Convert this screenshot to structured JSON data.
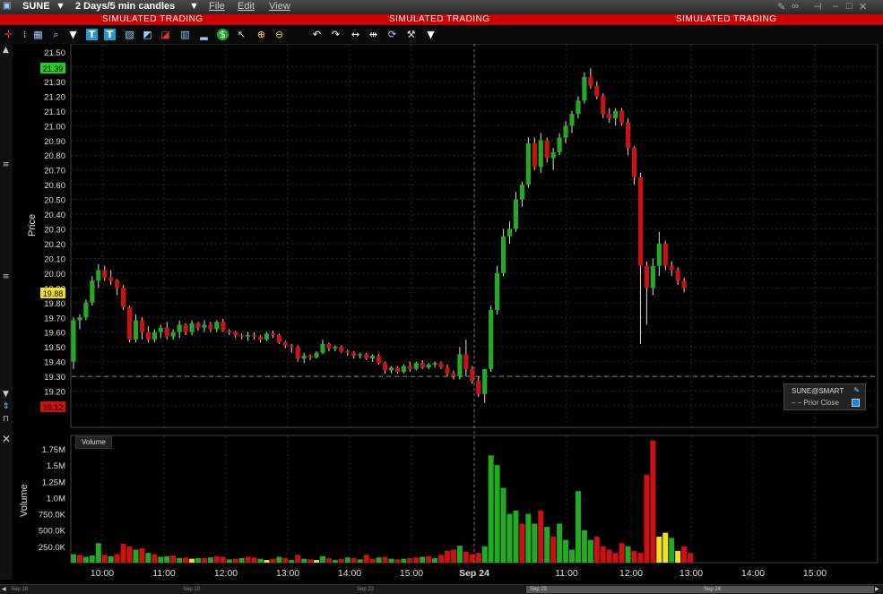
{
  "window": {
    "symbol": "SUNE",
    "period": "2 Days/5 min candles",
    "menus": [
      "File",
      "Edit",
      "View"
    ]
  },
  "banner": {
    "text": "SIMULATED TRADING",
    "color": "#cc0000"
  },
  "toolbar_icons": [
    "crosshair-icon",
    "dotted-grid-icon",
    "magnifier-icon",
    "dropdown-arrow-icon",
    "text-icon",
    "text-box-icon",
    "line-chart-icon",
    "area-chart-icon",
    "draw-line-icon",
    "bar-chart-icon",
    "volume-icon",
    "dollar-icon",
    "pointer-icon",
    "zoom-in-icon",
    "zoom-out-icon",
    "undo-icon",
    "redo-icon",
    "fit-icon",
    "split-icon",
    "refresh-icon",
    "wrench-icon",
    "more-arrow-icon"
  ],
  "price_panel": {
    "ylabel": "Price",
    "current_price_tag": "21.39",
    "prior_close_tag": "19.88",
    "low_tag": "19.12",
    "tick_labels": [
      "21.50",
      "21.40",
      "21.30",
      "21.20",
      "21.10",
      "21.00",
      "20.90",
      "20.80",
      "20.70",
      "20.60",
      "20.50",
      "20.40",
      "20.30",
      "20.20",
      "20.10",
      "20.00",
      "19.90",
      "19.80",
      "19.70",
      "19.60",
      "19.50",
      "19.40",
      "19.30",
      "19.20",
      "19.10"
    ]
  },
  "legend": {
    "title": "SUNE@SMART",
    "item": "Prior Close"
  },
  "volume_panel": {
    "badge": "Volume",
    "ylabel": "Volume",
    "tick_labels": [
      "1.75M",
      "1.5M",
      "1.25M",
      "1.0M",
      "750.0K",
      "500.0K",
      "250.0K"
    ]
  },
  "time_axis": {
    "labels": [
      "10:00",
      "11:00",
      "12:00",
      "13:00",
      "14:00",
      "15:00",
      "Sep 24",
      "11:00",
      "12:00",
      "13:00",
      "14:00",
      "15:00"
    ]
  },
  "scroller_labels": [
    "Sep 18",
    "Sep 19",
    "Sep 22",
    "Sep 23",
    "Sep 24"
  ],
  "colors": {
    "up": "#22aa22",
    "down": "#cc1111",
    "flat": "#eeeeee",
    "price_tag": "#22cc22",
    "prior_tag": "#f0e020",
    "low_tag": "#cc1111"
  },
  "chart_data": {
    "type": "candlestick",
    "ylim": [
      19.05,
      21.55
    ],
    "prior_close": 19.3,
    "ohlc": [
      [
        19.4,
        19.7,
        19.35,
        19.68
      ],
      [
        19.68,
        19.72,
        19.62,
        19.7
      ],
      [
        19.7,
        19.82,
        19.68,
        19.8
      ],
      [
        19.8,
        19.98,
        19.78,
        19.95
      ],
      [
        19.95,
        20.06,
        19.9,
        20.02
      ],
      [
        20.02,
        20.05,
        19.95,
        19.97
      ],
      [
        19.97,
        20.02,
        19.92,
        19.95
      ],
      [
        19.95,
        19.96,
        19.85,
        19.9
      ],
      [
        19.9,
        19.92,
        19.75,
        19.77
      ],
      [
        19.77,
        19.78,
        19.53,
        19.55
      ],
      [
        19.55,
        19.72,
        19.53,
        19.68
      ],
      [
        19.68,
        19.7,
        19.55,
        19.6
      ],
      [
        19.6,
        19.64,
        19.53,
        19.55
      ],
      [
        19.55,
        19.62,
        19.53,
        19.6
      ],
      [
        19.6,
        19.65,
        19.56,
        19.63
      ],
      [
        19.63,
        19.67,
        19.55,
        19.57
      ],
      [
        19.57,
        19.62,
        19.55,
        19.6
      ],
      [
        19.6,
        19.68,
        19.56,
        19.65
      ],
      [
        19.65,
        19.66,
        19.58,
        19.6
      ],
      [
        19.6,
        19.68,
        19.58,
        19.66
      ],
      [
        19.66,
        19.67,
        19.61,
        19.63
      ],
      [
        19.63,
        19.68,
        19.6,
        19.65
      ],
      [
        19.65,
        19.67,
        19.6,
        19.62
      ],
      [
        19.62,
        19.68,
        19.6,
        19.67
      ],
      [
        19.67,
        19.69,
        19.6,
        19.61
      ],
      [
        19.61,
        19.62,
        19.58,
        19.6
      ],
      [
        19.6,
        19.61,
        19.56,
        19.58
      ],
      [
        19.58,
        19.59,
        19.55,
        19.57
      ],
      [
        19.57,
        19.6,
        19.54,
        19.58
      ],
      [
        19.58,
        19.6,
        19.55,
        19.57
      ],
      [
        19.57,
        19.58,
        19.53,
        19.55
      ],
      [
        19.55,
        19.6,
        19.54,
        19.59
      ],
      [
        19.59,
        19.61,
        19.56,
        19.58
      ],
      [
        19.58,
        19.59,
        19.52,
        19.53
      ],
      [
        19.53,
        19.54,
        19.49,
        19.51
      ],
      [
        19.51,
        19.52,
        19.46,
        19.5
      ],
      [
        19.5,
        19.51,
        19.4,
        19.42
      ],
      [
        19.42,
        19.46,
        19.39,
        19.44
      ],
      [
        19.44,
        19.45,
        19.41,
        19.43
      ],
      [
        19.43,
        19.47,
        19.42,
        19.46
      ],
      [
        19.46,
        19.55,
        19.45,
        19.52
      ],
      [
        19.52,
        19.53,
        19.47,
        19.49
      ],
      [
        19.49,
        19.51,
        19.47,
        19.5
      ],
      [
        19.5,
        19.51,
        19.46,
        19.47
      ],
      [
        19.47,
        19.48,
        19.44,
        19.46
      ],
      [
        19.46,
        19.47,
        19.42,
        19.44
      ],
      [
        19.44,
        19.46,
        19.42,
        19.45
      ],
      [
        19.45,
        19.46,
        19.41,
        19.42
      ],
      [
        19.42,
        19.45,
        19.4,
        19.44
      ],
      [
        19.44,
        19.45,
        19.38,
        19.39
      ],
      [
        19.39,
        19.4,
        19.32,
        19.34
      ],
      [
        19.34,
        19.37,
        19.32,
        19.36
      ],
      [
        19.36,
        19.37,
        19.32,
        19.33
      ],
      [
        19.33,
        19.38,
        19.32,
        19.37
      ],
      [
        19.37,
        19.4,
        19.33,
        19.35
      ],
      [
        19.35,
        19.4,
        19.34,
        19.39
      ],
      [
        19.39,
        19.41,
        19.35,
        19.36
      ],
      [
        19.36,
        19.39,
        19.35,
        19.38
      ],
      [
        19.38,
        19.4,
        19.36,
        19.39
      ],
      [
        19.39,
        19.4,
        19.35,
        19.36
      ],
      [
        19.36,
        19.38,
        19.3,
        19.32
      ],
      [
        19.32,
        19.34,
        19.28,
        19.3
      ],
      [
        19.3,
        19.5,
        19.28,
        19.45
      ],
      [
        19.45,
        19.55,
        19.3,
        19.35
      ],
      [
        19.35,
        19.37,
        19.25,
        19.27
      ],
      [
        19.27,
        19.3,
        19.16,
        19.18
      ],
      [
        19.18,
        19.35,
        19.12,
        19.35
      ],
      [
        19.35,
        19.78,
        19.33,
        19.75
      ],
      [
        19.75,
        20.05,
        19.72,
        20.0
      ],
      [
        20.0,
        20.3,
        19.98,
        20.25
      ],
      [
        20.25,
        20.35,
        20.2,
        20.3
      ],
      [
        20.3,
        20.55,
        20.28,
        20.5
      ],
      [
        20.5,
        20.62,
        20.45,
        20.6
      ],
      [
        20.6,
        20.92,
        20.58,
        20.88
      ],
      [
        20.88,
        20.92,
        20.7,
        20.72
      ],
      [
        20.72,
        20.95,
        20.68,
        20.9
      ],
      [
        20.9,
        20.92,
        20.75,
        20.78
      ],
      [
        20.78,
        20.85,
        20.7,
        20.82
      ],
      [
        20.82,
        20.95,
        20.8,
        20.92
      ],
      [
        20.92,
        21.03,
        20.88,
        21.0
      ],
      [
        21.0,
        21.1,
        20.95,
        21.08
      ],
      [
        21.08,
        21.2,
        21.05,
        21.17
      ],
      [
        21.17,
        21.36,
        21.15,
        21.33
      ],
      [
        21.33,
        21.39,
        21.25,
        21.27
      ],
      [
        21.27,
        21.3,
        21.18,
        21.2
      ],
      [
        21.2,
        21.22,
        21.05,
        21.08
      ],
      [
        21.08,
        21.12,
        21.02,
        21.05
      ],
      [
        21.05,
        21.12,
        21.0,
        21.1
      ],
      [
        21.1,
        21.12,
        21.0,
        21.02
      ],
      [
        21.02,
        21.05,
        20.8,
        20.85
      ],
      [
        20.85,
        20.86,
        20.6,
        20.65
      ],
      [
        20.65,
        20.68,
        19.52,
        20.05
      ],
      [
        20.05,
        20.08,
        19.65,
        19.9
      ],
      [
        19.9,
        20.1,
        19.85,
        20.05
      ],
      [
        20.05,
        20.28,
        19.98,
        20.2
      ],
      [
        20.2,
        20.22,
        20.02,
        20.05
      ],
      [
        20.05,
        20.08,
        19.98,
        20.02
      ],
      [
        20.02,
        20.04,
        19.92,
        19.95
      ],
      [
        19.95,
        19.97,
        19.87,
        19.9
      ]
    ],
    "volume": [
      [
        130,
        0
      ],
      [
        120,
        1
      ],
      [
        90,
        0
      ],
      [
        110,
        0
      ],
      [
        300,
        0
      ],
      [
        120,
        1
      ],
      [
        100,
        0
      ],
      [
        130,
        1
      ],
      [
        290,
        1
      ],
      [
        250,
        1
      ],
      [
        200,
        0
      ],
      [
        220,
        1
      ],
      [
        150,
        0
      ],
      [
        130,
        1
      ],
      [
        90,
        0
      ],
      [
        100,
        0
      ],
      [
        110,
        1
      ],
      [
        70,
        0
      ],
      [
        80,
        1
      ],
      [
        60,
        2
      ],
      [
        70,
        0
      ],
      [
        70,
        1
      ],
      [
        80,
        0
      ],
      [
        100,
        1
      ],
      [
        90,
        1
      ],
      [
        50,
        0
      ],
      [
        60,
        1
      ],
      [
        70,
        0
      ],
      [
        90,
        1
      ],
      [
        80,
        1
      ],
      [
        60,
        0
      ],
      [
        40,
        2
      ],
      [
        60,
        1
      ],
      [
        90,
        0
      ],
      [
        70,
        1
      ],
      [
        40,
        0
      ],
      [
        120,
        1
      ],
      [
        60,
        0
      ],
      [
        50,
        1
      ],
      [
        40,
        2
      ],
      [
        100,
        0
      ],
      [
        70,
        1
      ],
      [
        40,
        0
      ],
      [
        60,
        1
      ],
      [
        80,
        0
      ],
      [
        70,
        1
      ],
      [
        50,
        0
      ],
      [
        120,
        1
      ],
      [
        60,
        1
      ],
      [
        80,
        0
      ],
      [
        90,
        1
      ],
      [
        60,
        0
      ],
      [
        50,
        1
      ],
      [
        60,
        0
      ],
      [
        70,
        1
      ],
      [
        80,
        1
      ],
      [
        90,
        0
      ],
      [
        100,
        1
      ],
      [
        70,
        0
      ],
      [
        120,
        1
      ],
      [
        180,
        1
      ],
      [
        200,
        1
      ],
      [
        260,
        0
      ],
      [
        170,
        1
      ],
      [
        130,
        1
      ],
      [
        150,
        1
      ],
      [
        250,
        0
      ],
      [
        1650,
        0
      ],
      [
        1500,
        0
      ],
      [
        1150,
        0
      ],
      [
        750,
        0
      ],
      [
        800,
        0
      ],
      [
        600,
        1
      ],
      [
        750,
        0
      ],
      [
        600,
        0
      ],
      [
        800,
        1
      ],
      [
        550,
        0
      ],
      [
        400,
        1
      ],
      [
        600,
        0
      ],
      [
        350,
        0
      ],
      [
        200,
        0
      ],
      [
        1100,
        0
      ],
      [
        500,
        0
      ],
      [
        350,
        0
      ],
      [
        400,
        1
      ],
      [
        250,
        1
      ],
      [
        200,
        1
      ],
      [
        150,
        1
      ],
      [
        300,
        1
      ],
      [
        250,
        0
      ],
      [
        180,
        1
      ],
      [
        150,
        1
      ],
      [
        1350,
        1
      ],
      [
        1880,
        1
      ],
      [
        400,
        2
      ],
      [
        460,
        2
      ],
      [
        380,
        0
      ],
      [
        180,
        2
      ],
      [
        250,
        1
      ],
      [
        150,
        1
      ]
    ]
  }
}
